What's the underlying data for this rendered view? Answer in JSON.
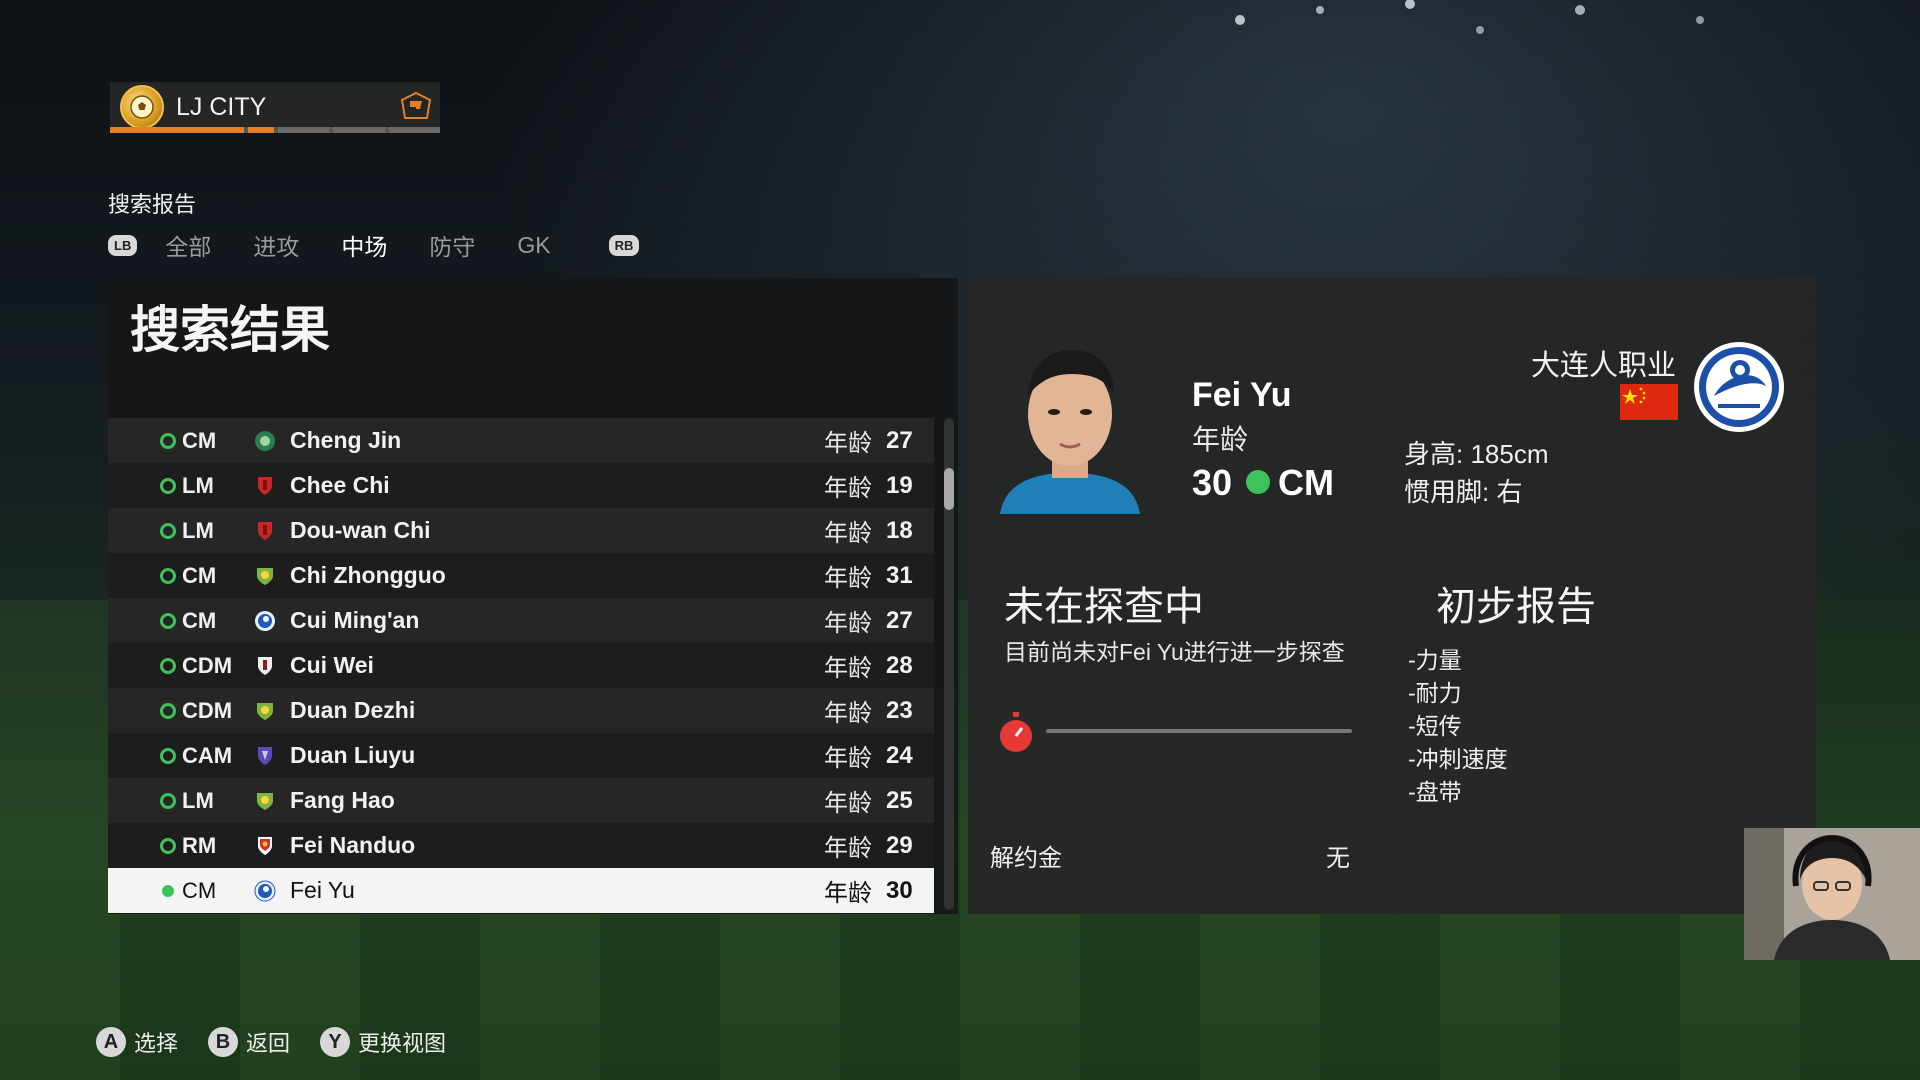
{
  "club": {
    "name": "LJ CITY"
  },
  "section": {
    "title": "搜索报告"
  },
  "tabs": {
    "lb": "LB",
    "rb": "RB",
    "items": [
      {
        "label": "全部",
        "active": false
      },
      {
        "label": "进攻",
        "active": false
      },
      {
        "label": "中场",
        "active": true
      },
      {
        "label": "防守",
        "active": false
      },
      {
        "label": "GK",
        "active": false
      }
    ]
  },
  "results": {
    "heading": "搜索结果",
    "age_label": "年龄",
    "rows": [
      {
        "pos": "CM",
        "name": "Cheng Jin",
        "age": "27",
        "team_icon": "green-round-crest-icon"
      },
      {
        "pos": "LM",
        "name": "Chee Chi",
        "age": "19",
        "team_icon": "red-shield-crest-icon"
      },
      {
        "pos": "LM",
        "name": "Dou-wan Chi",
        "age": "18",
        "team_icon": "red-shield-crest-icon"
      },
      {
        "pos": "CM",
        "name": "Chi Zhongguo",
        "age": "31",
        "team_icon": "green-yellow-crest-icon"
      },
      {
        "pos": "CM",
        "name": "Cui Ming'an",
        "age": "27",
        "team_icon": "blue-round-crest-icon"
      },
      {
        "pos": "CDM",
        "name": "Cui Wei",
        "age": "28",
        "team_icon": "white-shield-crest-icon"
      },
      {
        "pos": "CDM",
        "name": "Duan Dezhi",
        "age": "23",
        "team_icon": "green-yellow-crest-icon"
      },
      {
        "pos": "CAM",
        "name": "Duan Liuyu",
        "age": "24",
        "team_icon": "purple-shield-crest-icon"
      },
      {
        "pos": "LM",
        "name": "Fang Hao",
        "age": "25",
        "team_icon": "green-yellow-crest-icon"
      },
      {
        "pos": "RM",
        "name": "Fei Nanduo",
        "age": "29",
        "team_icon": "red-white-crest-icon"
      },
      {
        "pos": "CM",
        "name": "Fei Yu",
        "age": "30",
        "team_icon": "blue-round-crest-icon",
        "selected": true
      }
    ]
  },
  "player": {
    "name": "Fei Yu",
    "age_caption": "年龄",
    "age": "30",
    "position": "CM",
    "club": "大连人职业",
    "nation_flag": "china-flag-icon",
    "height": "身高: 185cm",
    "foot": "惯用脚: 右"
  },
  "scouting": {
    "title": "未在探查中",
    "description": "目前尚未对Fei Yu进行进一步探查",
    "progress": 0
  },
  "report": {
    "title": "初步报告",
    "items": [
      "-力量",
      "-耐力",
      "-短传",
      "-冲刺速度",
      "-盘带"
    ]
  },
  "release": {
    "label": "解约金",
    "value": "无"
  },
  "footer": [
    {
      "button": "A",
      "label": "选择"
    },
    {
      "button": "B",
      "label": "返回"
    },
    {
      "button": "Y",
      "label": "更换视图"
    }
  ],
  "colors": {
    "accent": "#e67e22",
    "status_green": "#3ec35a",
    "flag_red": "#de2910"
  }
}
